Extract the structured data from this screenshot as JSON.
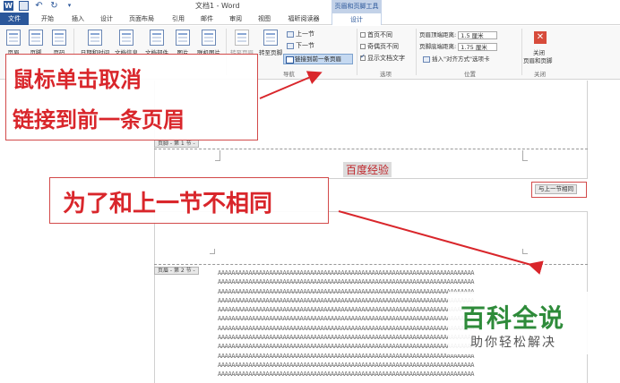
{
  "titlebar": {
    "title": "文档1 - Word",
    "context_group": "页眉和页脚工具"
  },
  "tabs": [
    "文件",
    "开始",
    "插入",
    "设计",
    "页面布局",
    "引用",
    "邮件",
    "审阅",
    "视图",
    "福昕阅读器",
    "设计"
  ],
  "ribbon": {
    "buttons": [
      "页眉",
      "页脚",
      "页码",
      "日期和时间",
      "文档信息",
      "文档部件",
      "图片",
      "联机图片",
      "转至页眉",
      "转至页脚"
    ],
    "nav_prev": "上一节",
    "nav_next": "下一节",
    "link_prev": "链接到前一条页眉",
    "nav_group_label": "导航",
    "options": [
      {
        "label": "首页不同",
        "checked": false
      },
      {
        "label": "奇偶页不同",
        "checked": false
      },
      {
        "label": "显示文档文字",
        "checked": true
      }
    ],
    "options_group_label": "选项",
    "header_top_label": "页眉顶端距离:",
    "header_top_value": "1.5 厘米",
    "footer_bottom_label": "页脚底端距离:",
    "footer_bottom_value": "1.75 厘米",
    "insert_align_tab": "插入\"对齐方式\"选项卡",
    "position_group_label": "位置",
    "close_label_1": "关闭",
    "close_label_2": "页眉和页脚",
    "close_group_label": "关闭"
  },
  "document": {
    "footer_tag": "页脚 - 第 1 节 -",
    "header_tag": "页眉 - 第 2 节 -",
    "header_text": "百度经验",
    "same_as_previous": "与上一节相同",
    "body_lines": [
      "AAAAAAAAAAAAAAAAAAAAAAAAAAAAAAAAAAAAAAAAAAAAAAAAAAAAAAAAAAAAAAAAAAAAAAAAAAA",
      "AAAAAAAAAAAAAAAAAAAAAAAAAAAAAAAAAAAAAAAAAAAAAAAAAAAAAAAAAAAAAAAAAAAAAAAAAAA",
      "AAAAAAAAAAAAAAAAAAAAAAAAAAAAAAAAAAAAAAAAAAAAAAAAAAAAAAAAAAAAAAAAAAAAAAAAAAA",
      "AAAAAAAAAAAAAAAAAAAAAAAAAAAAAAAAAAAAAAAAAAAAAAAAAAAAAAAAAAAAAAAAAAAAAAAAAAA",
      "AAAAAAAAAAAAAAAAAAAAAAAAAAAAAAAAAAAAAAAAAAAAAAAAAAAAAAAAAAAAAAAAAAAAAAAAAAA",
      "AAAAAAAAAAAAAAAAAAAAAAAAAAAAAAAAAAAAAAAAAAAAAAAAAAAAAAAAAAAAAAAAAAAAAAAAAAA",
      "AAAAAAAAAAAAAAAAAAAAAAAAAAAAAAAAAAAAAAAAAAAAAAAAAAAAAAAAAAAAAAAAAAAAAAAAAAA",
      "AAAAAAAAAAAAAAAAAAAAAAAAAAAAAAAAAAAAAAAAAAAAAAAAAAAAAAAAAAAAAAAAAAAAAAAAAAA",
      "AAAAAAAAAAAAAAAAAAAAAAAAAAAAAAAAAAAAAAAAAAAAAAAAAAAAAAAAAAAAAAAAAAAAAAAAAAA",
      "AAAAAAAAAAAAAAAAAAAAAAAAAAAAAAAAAAAAAAAAAAAAAAAAAAAAAAAAAAAAAAAAAAAAAAAAAAA",
      "AAAAAAAAAAAAAAAAAAAAAAAAAAAAAAAAAAAAAAAAAAAAAAAAAAAAAAAAAAAAAAAAAAAAAAAAAAA",
      "AAAAAAAAAAAAAAAAAAAAAAAAAAAAAAAAAAAAAAAAAAAAAAAAAAAAAAAAAAAAAAAAAAAAAAAAAAA"
    ]
  },
  "annotations": {
    "line1": "鼠标单击取消",
    "line2": "链接到前一条页眉",
    "line3": "为了和上一节不相同"
  },
  "brand": {
    "main": "百科全说",
    "sub": "助你轻松解决"
  },
  "colors": {
    "accent": "#2b579a",
    "annotation": "#d9262b",
    "brand": "#2e8b3a"
  }
}
